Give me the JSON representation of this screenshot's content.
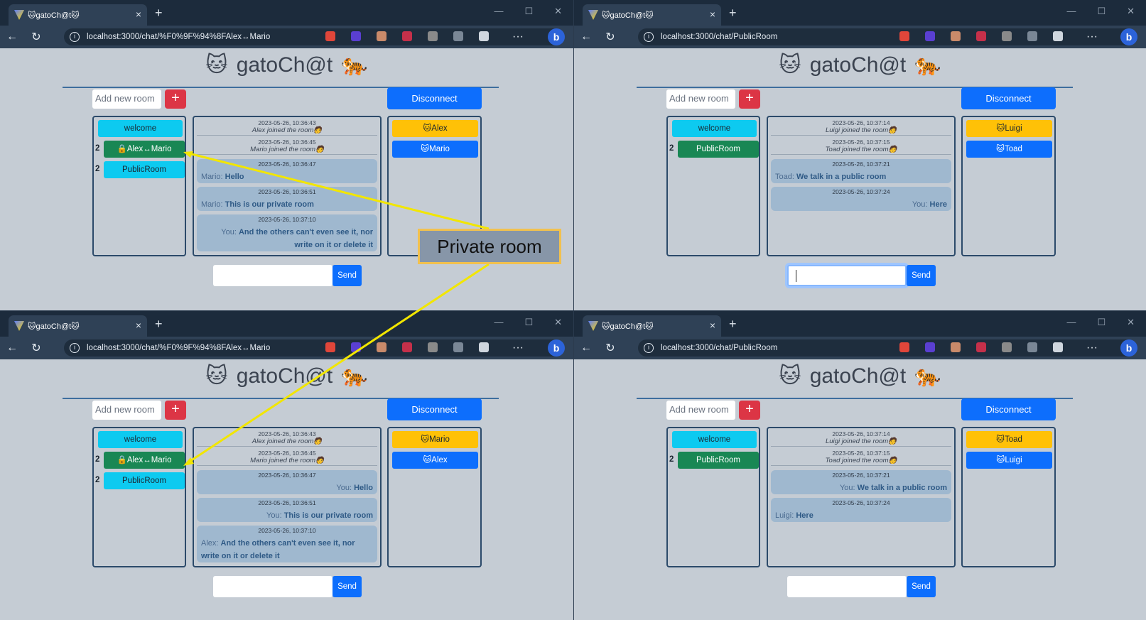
{
  "browser": {
    "tab_title": "🐱gatoCh@t🐱",
    "new_tab": "+",
    "close_tab": "×",
    "window_controls": [
      "—",
      "☐",
      "✕"
    ],
    "nav_back": "←",
    "nav_refresh": "↻",
    "more": "···",
    "bing": "b"
  },
  "app": {
    "title": "gatoCh@t",
    "add_room_placeholder": "Add new room",
    "add_room_button": "+",
    "disconnect": "Disconnect",
    "send": "Send"
  },
  "windows": [
    {
      "url": "localhost:3000/chat/%F0%9F%94%8FAlex↔Mario",
      "rooms": [
        {
          "label": "welcome",
          "count": "",
          "type": "welcome"
        },
        {
          "label": "🔒Alex↔Mario",
          "count": "2",
          "type": "priv"
        },
        {
          "label": "PublicRoom",
          "count": "2",
          "type": "pub"
        }
      ],
      "system_msgs": [
        {
          "ts": "2023-05-26, 10:36:43",
          "text": "Alex joined the room🧑"
        },
        {
          "ts": "2023-05-26, 10:36:45",
          "text": "Mario joined the room🧑"
        }
      ],
      "messages": [
        {
          "ts": "2023-05-26, 10:36:47",
          "sender": "Mario: ",
          "text": "Hello",
          "me": false
        },
        {
          "ts": "2023-05-26, 10:36:51",
          "sender": "Mario: ",
          "text": "This is our private room",
          "me": false
        },
        {
          "ts": "2023-05-26, 10:37:10",
          "sender": "You: ",
          "text": "And the others can't even see it, nor write on it or delete it",
          "me": true
        }
      ],
      "users": [
        {
          "label": "🐱Alex",
          "self": true
        },
        {
          "label": "🐱Mario",
          "self": false
        }
      ],
      "input_focused": false
    },
    {
      "url": "localhost:3000/chat/PublicRoom",
      "rooms": [
        {
          "label": "welcome",
          "count": "",
          "type": "welcome"
        },
        {
          "label": "PublicRoom",
          "count": "2",
          "type": "priv"
        }
      ],
      "system_msgs": [
        {
          "ts": "2023-05-26, 10:37:14",
          "text": "Luigi joined the room🧑"
        },
        {
          "ts": "2023-05-26, 10:37:15",
          "text": "Toad joined the room🧑"
        }
      ],
      "messages": [
        {
          "ts": "2023-05-26, 10:37:21",
          "sender": "Toad: ",
          "text": "We talk in a public room",
          "me": false
        },
        {
          "ts": "2023-05-26, 10:37:24",
          "sender": "You: ",
          "text": "Here",
          "me": true
        }
      ],
      "users": [
        {
          "label": "🐱Luigi",
          "self": true
        },
        {
          "label": "🐱Toad",
          "self": false
        }
      ],
      "input_focused": true
    },
    {
      "url": "localhost:3000/chat/%F0%9F%94%8FAlex↔Mario",
      "rooms": [
        {
          "label": "welcome",
          "count": "",
          "type": "welcome"
        },
        {
          "label": "🔒Alex↔Mario",
          "count": "2",
          "type": "priv"
        },
        {
          "label": "PublicRoom",
          "count": "2",
          "type": "pub"
        }
      ],
      "system_msgs": [
        {
          "ts": "2023-05-26, 10:36:43",
          "text": "Alex joined the room🧑"
        },
        {
          "ts": "2023-05-26, 10:36:45",
          "text": "Mario joined the room🧑"
        }
      ],
      "messages": [
        {
          "ts": "2023-05-26, 10:36:47",
          "sender": "You: ",
          "text": "Hello",
          "me": true
        },
        {
          "ts": "2023-05-26, 10:36:51",
          "sender": "You: ",
          "text": "This is our private room",
          "me": true
        },
        {
          "ts": "2023-05-26, 10:37:10",
          "sender": "Alex: ",
          "text": "And the others can't even see it, nor write on it or delete it",
          "me": false
        }
      ],
      "users": [
        {
          "label": "🐱Mario",
          "self": true
        },
        {
          "label": "🐱Alex",
          "self": false
        }
      ],
      "input_focused": false
    },
    {
      "url": "localhost:3000/chat/PublicRoom",
      "rooms": [
        {
          "label": "welcome",
          "count": "",
          "type": "welcome"
        },
        {
          "label": "PublicRoom",
          "count": "2",
          "type": "priv"
        }
      ],
      "system_msgs": [
        {
          "ts": "2023-05-26, 10:37:14",
          "text": "Luigi joined the room🧑"
        },
        {
          "ts": "2023-05-26, 10:37:15",
          "text": "Toad joined the room🧑"
        }
      ],
      "messages": [
        {
          "ts": "2023-05-26, 10:37:21",
          "sender": "You: ",
          "text": "We talk in a public room",
          "me": true
        },
        {
          "ts": "2023-05-26, 10:37:24",
          "sender": "Luigi: ",
          "text": "Here",
          "me": false
        }
      ],
      "users": [
        {
          "label": "🐱Toad",
          "self": true
        },
        {
          "label": "🐱Luigi",
          "self": false
        }
      ],
      "input_focused": false
    }
  ],
  "annotation": {
    "label": "Private room",
    "color": "#f2e600"
  }
}
